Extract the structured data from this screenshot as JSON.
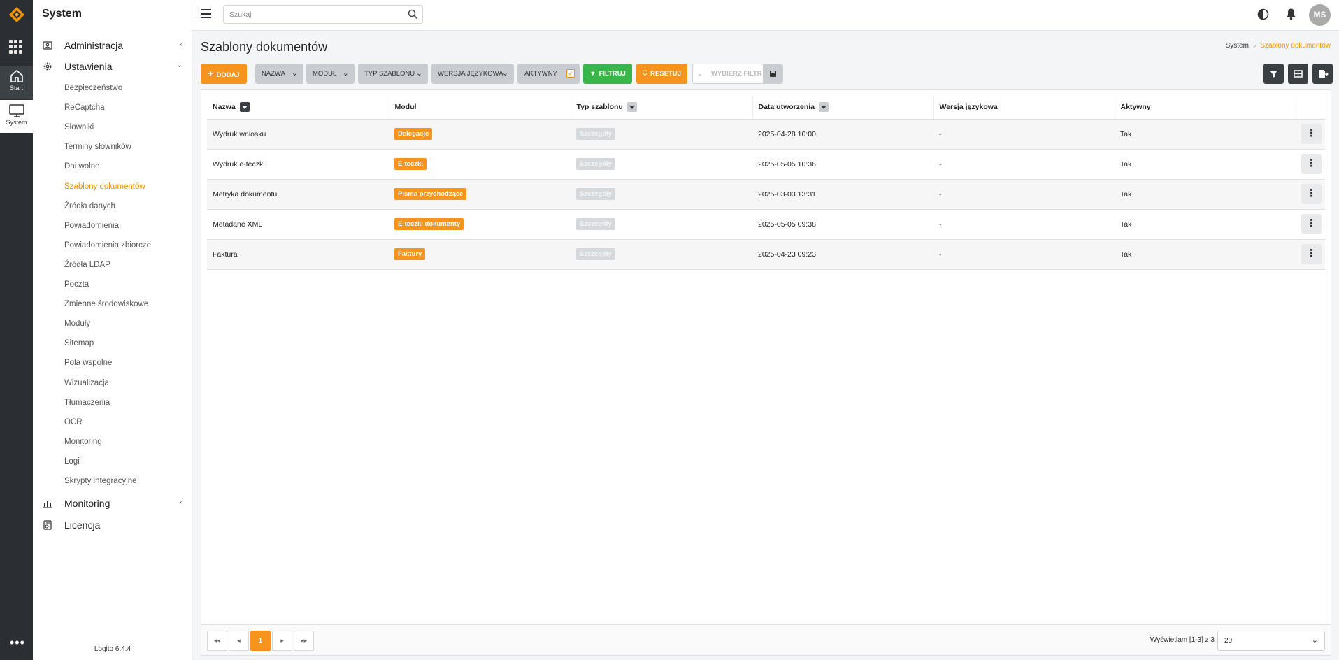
{
  "rail": {
    "start_label": "Start",
    "system_label": "System",
    "more": "•••"
  },
  "sidebar": {
    "title": "System",
    "groups": [
      {
        "label": "Administracja",
        "icon": "id-card-icon",
        "chevron": "‹"
      },
      {
        "label": "Ustawienia",
        "icon": "gear-icon",
        "chevron": "⌄"
      },
      {
        "label": "Monitoring",
        "icon": "chart-icon",
        "chevron": "‹"
      },
      {
        "label": "Licencja",
        "icon": "license-icon",
        "chevron": ""
      }
    ],
    "subitems": [
      "Bezpieczeństwo",
      "ReCaptcha",
      "Słowniki",
      "Terminy słowników",
      "Dni wolne",
      "Szablony dokumentów",
      "Źródła danych",
      "Powiadomienia",
      "Powiadomienia zbiorcze",
      "Źródła LDAP",
      "Poczta",
      "Zmienne środowiskowe",
      "Moduły",
      "Sitemap",
      "Pola wspólne",
      "Wizualizacja",
      "Tłumaczenia",
      "OCR",
      "Monitoring",
      "Logi",
      "Skrypty integracyjne"
    ],
    "active_subitem": 5,
    "version": "Logito 6.4.4"
  },
  "topbar": {
    "search_placeholder": "Szukaj",
    "avatar": "MS"
  },
  "header": {
    "title": "Szablony dokumentów",
    "breadcrumb": [
      "System",
      "Szablony dokumentów"
    ]
  },
  "toolbar": {
    "add": "DODAJ",
    "nazwa": "NAZWA",
    "modul": "MODUŁ",
    "typ": "TYP SZABLONU",
    "wersja": "WERSJA JĘZYKOWA",
    "aktywny": "AKTYWNY",
    "filtruj": "FILTRUJ",
    "resetuj": "RESETUJ",
    "wybierz_filtr": "WYBIERZ FILTR"
  },
  "table": {
    "columns": [
      "Nazwa",
      "Moduł",
      "Typ szablonu",
      "Data utworzenia",
      "Wersja językowa",
      "Aktywny"
    ],
    "rows": [
      {
        "nazwa": "Wydruk wniosku",
        "modul": "Delegacje",
        "typ": "Szczegóły",
        "data": "2025-04-28 10:00",
        "wersja": "-",
        "aktywny": "Tak"
      },
      {
        "nazwa": "Wydruk e-teczki",
        "modul": "E-teczki",
        "typ": "Szczegóły",
        "data": "2025-05-05 10:36",
        "wersja": "-",
        "aktywny": "Tak"
      },
      {
        "nazwa": "Metryka dokumentu",
        "modul": "Pisma przychodzące",
        "typ": "Szczegóły",
        "data": "2025-03-03 13:31",
        "wersja": "-",
        "aktywny": "Tak"
      },
      {
        "nazwa": "Metadane XML",
        "modul": "E-teczki dokumenty",
        "typ": "Szczegóły",
        "data": "2025-05-05 09:38",
        "wersja": "-",
        "aktywny": "Tak"
      },
      {
        "nazwa": "Faktura",
        "modul": "Faktury",
        "typ": "Szczegóły",
        "data": "2025-04-23 09:23",
        "wersja": "-",
        "aktywny": "Tak"
      }
    ],
    "kebab": "⋮"
  },
  "footer": {
    "current_page": "1",
    "info": "Wyświetlam [1-3] z 3",
    "page_size": "20"
  },
  "colors": {
    "accent": "#f7941d",
    "green": "#3ab54a",
    "dark": "#2b2f33"
  }
}
